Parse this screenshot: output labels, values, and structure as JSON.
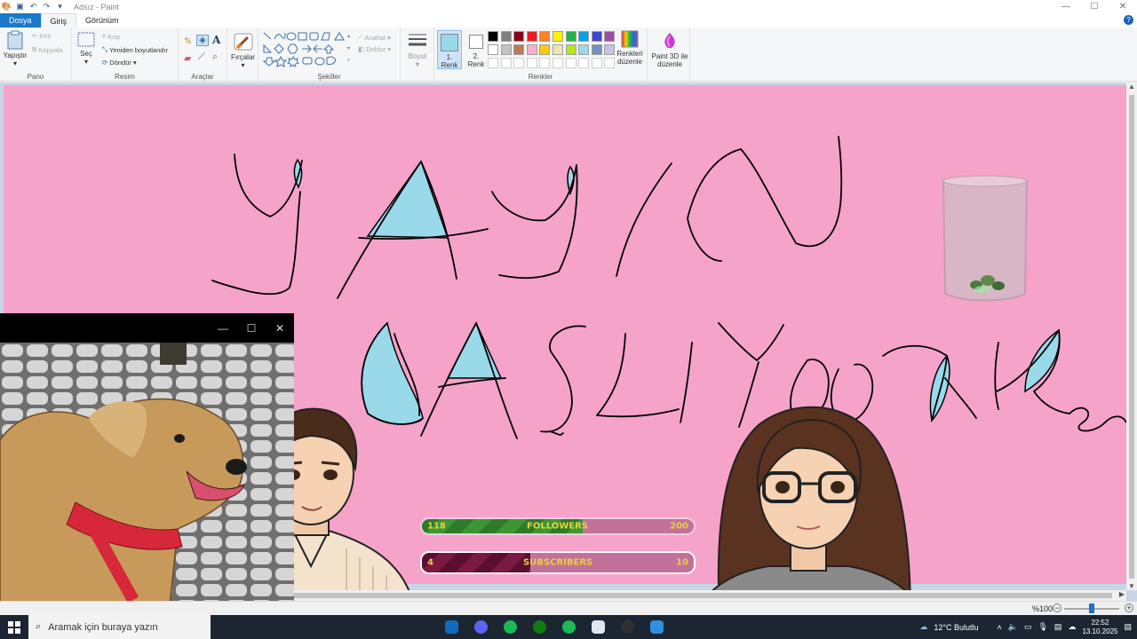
{
  "window": {
    "title": "Adsız - Paint",
    "minimize": "—",
    "maximize": "☐",
    "close": "✕"
  },
  "menu": {
    "file": "Dosya",
    "home": "Giriş",
    "view": "Görünüm",
    "help": "?"
  },
  "ribbon": {
    "clipboard": {
      "label": "Pano",
      "paste": "Yapıştır",
      "cut": "Kes",
      "copy": "Kopyala"
    },
    "image": {
      "label": "Resim",
      "select": "Seç",
      "crop": "Kırp",
      "resize": "Yeniden boyutlandır",
      "rotate": "Döndür"
    },
    "tools": {
      "label": "Araçlar"
    },
    "brushes": {
      "label": "Fırçalar"
    },
    "shapes": {
      "label": "Şekiller",
      "outline": "Anahat",
      "fill": "Doldur"
    },
    "size": {
      "label": "Boyut"
    },
    "colors": {
      "label": "Renkler",
      "color1_line1": "1.",
      "color1_line2": "Renk",
      "color2_line1": "2.",
      "color2_line2": "Renk",
      "edit_line1": "Renkleri",
      "edit_line2": "düzenle",
      "color1": "#99d9ea",
      "color2": "#ffffff",
      "palette_row1": [
        "#000000",
        "#7f7f7f",
        "#880015",
        "#ed1c24",
        "#ff7f27",
        "#fff200",
        "#22b14c",
        "#00a2e8",
        "#3f48cc",
        "#a349a4"
      ],
      "palette_row2": [
        "#ffffff",
        "#c3c3c3",
        "#b97a57",
        "#ffaec9",
        "#ffc90e",
        "#efe4b0",
        "#b5e61d",
        "#99d9ea",
        "#7092be",
        "#c8bfe7"
      ]
    },
    "paint3d": {
      "line1": "Paint 3D ile",
      "line2": "düzenle"
    }
  },
  "canvas": {
    "background": "#f6a3c9",
    "ink_accent": "#99d9ea"
  },
  "overlays": {
    "followers": {
      "current": "118",
      "label": "FOLLOWERS",
      "goal": "200",
      "progress": 0.59
    },
    "subscribers": {
      "current": "4",
      "label": "SUBSCRIBERS",
      "goal": "10",
      "progress": 0.4
    }
  },
  "camera_window": {
    "minimize": "—",
    "maximize": "☐",
    "close": "✕"
  },
  "status": {
    "zoom": "%100",
    "zoom_out": "−",
    "zoom_in": "+",
    "zoom_level": 0.5
  },
  "taskbar": {
    "search_placeholder": "Aramak için buraya yazın",
    "weather": "12°C  Bulutlu",
    "time": "22:52",
    "date": "13.10.2025",
    "apps": [
      "outlook-icon",
      "discord-icon",
      "spotify-icon",
      "xbox-icon",
      "spotify-icon",
      "browser-icon",
      "obs-icon",
      "paint-icon"
    ]
  }
}
